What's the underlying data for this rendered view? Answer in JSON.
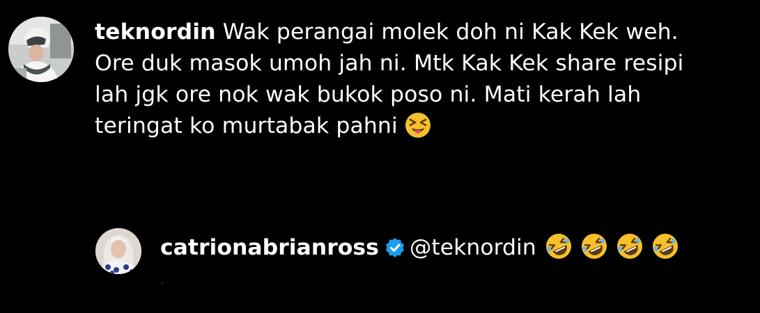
{
  "comment": {
    "username": "teknordin",
    "text_line1": "Wak perangai molek doh ni Kak Kek weh.",
    "text_line2": "Ore duk masok umoh jah ni. Mtk Kak Kek share resipi",
    "text_line3": "lah jgk ore nok wak bukok poso ni. Mati kerah lah",
    "text_line4": "teringat ko murtabak pahni",
    "emoji": "squinting-face-with-tongue-icon"
  },
  "reply": {
    "username": "catrionabrianross",
    "verified_badge": "verified-badge-icon",
    "mention": "@teknordin",
    "emojis": [
      "rolling-on-floor-laughing-icon",
      "rolling-on-floor-laughing-icon",
      "rolling-on-floor-laughing-icon",
      "rolling-on-floor-laughing-icon"
    ]
  },
  "colors": {
    "background": "#000000",
    "text": "#ffffff",
    "verified_blue": "#1d9bf0",
    "emoji_yellow": "#f7c02b"
  }
}
